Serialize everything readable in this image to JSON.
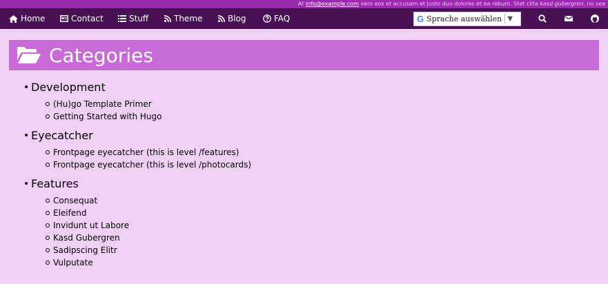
{
  "topbar": {
    "prefix": "At ",
    "email": "info@example.com",
    "mid": " vero eos et ",
    "accusam": "accusam",
    "rest": " et justo duo dolores et ea rebum. Stet clita ",
    "kasd": "kasd gubergren",
    "end": ", no sea"
  },
  "nav": {
    "home": "Home",
    "contact": "Contact",
    "stuff": "Stuff",
    "theme": "Theme",
    "blog": "Blog",
    "faq": "FAQ"
  },
  "language": {
    "label": "Sprache auswählen",
    "google_letter": "G",
    "arrow": "▼"
  },
  "page": {
    "title": "Categories"
  },
  "categories": [
    {
      "name": "Development",
      "items": [
        "(Hu)go Template Primer",
        "Getting Started with Hugo"
      ]
    },
    {
      "name": "Eyecatcher",
      "items": [
        "Frontpage eyecatcher (this is level /features)",
        "Frontpage eyecatcher (this is level /photocards)"
      ]
    },
    {
      "name": "Features",
      "items": [
        "Consequat",
        "Eleifend",
        "Invidunt ut Labore",
        "Kasd Gubergren",
        "Sadipscing Elitr",
        "Vulputate"
      ]
    }
  ],
  "colors": {
    "topbar": "#9c27b0",
    "navbar": "#4a1055",
    "title_bar": "#c86ad8",
    "background": "#f0d0f5"
  },
  "icons": [
    "home-icon",
    "contact-card-icon",
    "list-icon",
    "rss-icon",
    "rss-icon",
    "question-circle-icon",
    "search-icon",
    "envelope-icon",
    "github-icon",
    "folder-open-icon"
  ]
}
